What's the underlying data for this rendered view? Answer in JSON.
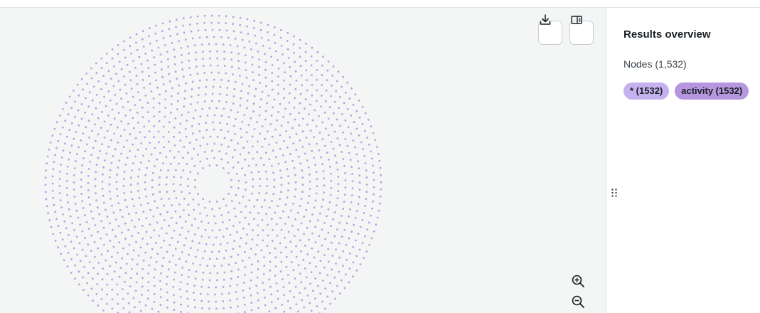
{
  "toolbar": {
    "download_icon": "download-icon",
    "panel_toggle_icon": "sidebar-panel-icon",
    "zoom_in_icon": "zoom-in-icon",
    "zoom_out_icon": "zoom-out-icon"
  },
  "graph": {
    "node_color": "#b9a3e3",
    "canvas_background": "#f4f5f5",
    "node_count": 1532,
    "layout": "concentric rings with empty center"
  },
  "panel": {
    "title": "Results overview",
    "nodes_label": "Nodes (1,532)",
    "chips": [
      {
        "label": "* (1532)",
        "color": "#c4b1ee"
      },
      {
        "label": "activity (1532)",
        "color": "#b697df"
      }
    ],
    "drag_handle_icon": "drag-handle-icon"
  },
  "colors": {
    "divider": "#e2e4e6",
    "text_primary": "#1a1f24",
    "text_secondary": "#3b434b"
  }
}
